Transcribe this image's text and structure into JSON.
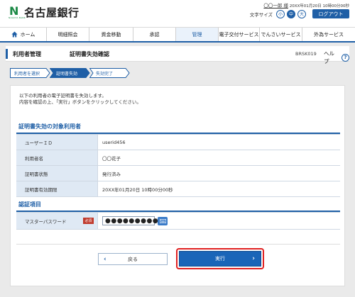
{
  "header": {
    "bank_name": "名古屋銀行",
    "logo_sub": "NAGOYA BANK",
    "user_name": "〇〇一郎 様",
    "last_login": "20XX年01月20日 10時00分00秒",
    "font_size_label": "文字サイズ",
    "font_sizes": [
      "小",
      "中",
      "大"
    ],
    "logout": "ログアウト"
  },
  "nav": [
    "ホーム",
    "明細照会",
    "資金移動",
    "承認",
    "管理",
    "電子交付サービス",
    "でんさいサービス",
    "外為サービス"
  ],
  "page": {
    "category": "利用者管理",
    "title": "証明書失効確認",
    "screen_id": "BRSK019",
    "help": "ヘルプ"
  },
  "steps": [
    "利用者を選択",
    "証明書失効",
    "失効完了"
  ],
  "intro": [
    "以下の利用者の電子証明書を失効します。",
    "内容を確認の上、「実行」ボタンをクリックしてください。"
  ],
  "target_section": {
    "title": "証明書失効の対象利用者",
    "rows": [
      {
        "label": "ユーザーＩＤ",
        "value": "userid456"
      },
      {
        "label": "利用者名",
        "value": "〇〇花子"
      },
      {
        "label": "証明書状態",
        "value": "発行済み"
      },
      {
        "label": "証明書有効期限",
        "value": "20XX年01月20日 10時00分00秒"
      }
    ]
  },
  "auth_section": {
    "title": "認証項目",
    "label": "マスターパスワード",
    "required": "必須",
    "password_value": "●●●●●●●●●"
  },
  "buttons": {
    "back": "戻る",
    "execute": "実行"
  },
  "colors": {
    "accent": "#1f5fa6",
    "execute": "#1a65b8",
    "highlight": "#e02020",
    "required": "#c0392b"
  }
}
